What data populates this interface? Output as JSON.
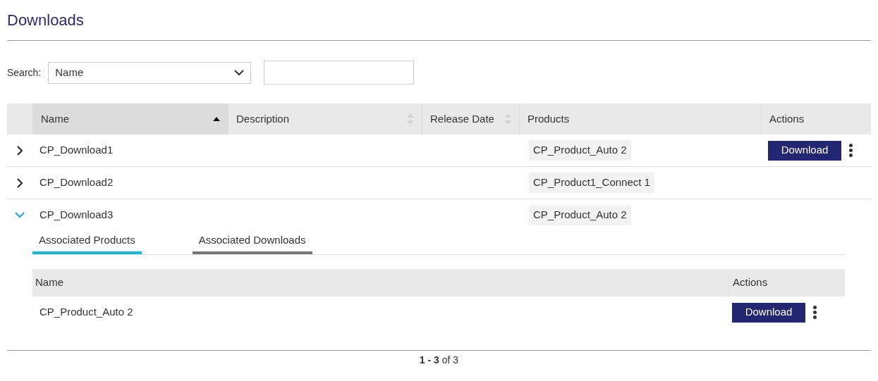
{
  "page": {
    "title": "Downloads"
  },
  "search": {
    "label": "Search:",
    "field": "Name"
  },
  "table": {
    "columns": [
      {
        "label": "Name",
        "sortable": true,
        "sorted": true
      },
      {
        "label": "Description",
        "sortable": true,
        "sorted": false
      },
      {
        "label": "Release Date",
        "sortable": true,
        "sorted": false
      },
      {
        "label": "Products",
        "sortable": false,
        "sorted": false
      },
      {
        "label": "Actions",
        "sortable": false,
        "sorted": false
      }
    ],
    "rows": [
      {
        "expanded": false,
        "name": "CP_Download1",
        "products": [
          "CP_Product_Auto 2"
        ],
        "action": "Download"
      },
      {
        "expanded": false,
        "name": "CP_Download2",
        "products": [
          "CP_Product1_Connect 1"
        ]
      },
      {
        "expanded": true,
        "name": "CP_Download3",
        "products": [
          "CP_Product_Auto 2"
        ],
        "detail": {
          "tabs": [
            {
              "label": "Associated Products",
              "selected": true
            },
            {
              "label": "Associated Downloads",
              "selected": false
            }
          ],
          "columns": [
            "Name",
            "Actions"
          ],
          "rows": [
            {
              "name": "CP_Product_Auto 2",
              "action": "Download"
            }
          ]
        }
      }
    ]
  },
  "pagination": "**1 - 3** of 3"
}
